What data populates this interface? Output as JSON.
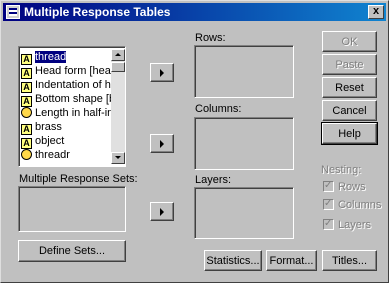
{
  "window": {
    "title": "Multiple Response Tables",
    "close_glyph": "x"
  },
  "variables": {
    "items": [
      {
        "label": "thread",
        "selected": true,
        "kind": "nominal"
      },
      {
        "label": "Head form [head",
        "kind": "nominal"
      },
      {
        "label": "Indentation of he",
        "kind": "nominal"
      },
      {
        "label": "Bottom shape [bo",
        "kind": "nominal"
      },
      {
        "label": "Length in half-inc",
        "kind": "scale"
      },
      {
        "label": "brass",
        "kind": "nominal"
      },
      {
        "label": "object",
        "kind": "nominal"
      },
      {
        "label": "threadr",
        "kind": "scale"
      }
    ]
  },
  "mr_sets": {
    "label": "Multiple Response Sets:",
    "define_button": "Define Sets..."
  },
  "targets": {
    "rows_label": "Rows:",
    "columns_label": "Columns:",
    "layers_label": "Layers:"
  },
  "buttons": {
    "ok": "OK",
    "paste": "Paste",
    "reset": "Reset",
    "cancel": "Cancel",
    "help": "Help",
    "statistics": "Statistics...",
    "format": "Format...",
    "titles": "Titles..."
  },
  "nesting": {
    "label": "Nesting:",
    "rows": "Rows",
    "columns": "Columns",
    "layers": "Layers"
  },
  "colors": {
    "face": "#c0c0c0",
    "title_start": "#000080",
    "title_end": "#1084d0",
    "selection": "#000080"
  }
}
